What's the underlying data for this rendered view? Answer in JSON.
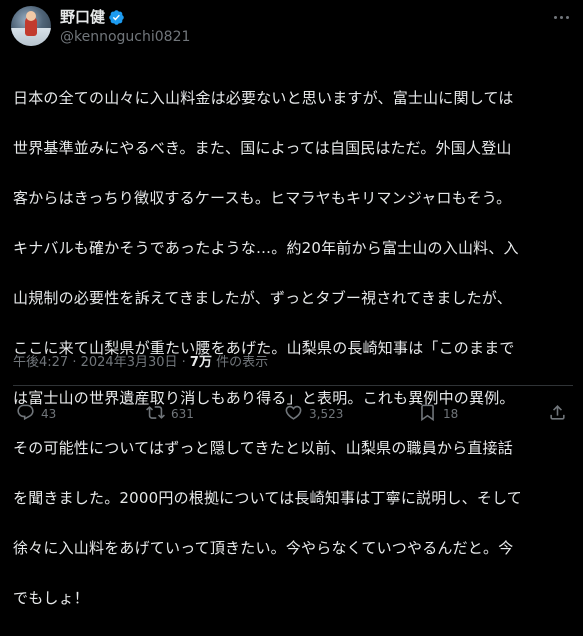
{
  "author": {
    "display_name": "野口健",
    "handle": "@kennoguchi0821",
    "verified_color": "#1d9bf0"
  },
  "post": {
    "lines": [
      "日本の全ての山々に入山料金は必要ないと思いますが、富士山に関しては",
      "世界基準並みにやるべき。また、国によっては自国民はただ。外国人登山",
      "客からはきっちり徴収するケースも。ヒマラヤもキリマンジャロもそう。",
      "キナバルも確かそうであったような…。約20年前から富士山の入山料、入",
      "山規制の必要性を訴えてきましたが、ずっとタブー視されてきましたが、",
      "ここに来て山梨県が重たい腰をあげた。山梨県の長崎知事は「このままで",
      "は富士山の世界遺産取り消しもあり得る」と表明。これも異例中の異例。",
      "その可能性についてはずっと隠してきたと以前、山梨県の職員から直接話",
      "を聞きました。2000円の根拠については長崎知事は丁寧に説明し、そして",
      "徐々に入山料をあげていって頂きたい。今やらなくていつやるんだと。今",
      "でもしょ！"
    ]
  },
  "meta": {
    "time": "午後4:27",
    "separator": " · ",
    "date": "2024年3月30日",
    "views_count": "7万",
    "views_label": " 件の表示"
  },
  "actions": {
    "replies": "43",
    "reposts": "631",
    "likes": "3,523",
    "bookmarks": "18"
  },
  "colors": {
    "background": "#000000",
    "text": "#e7e9ea",
    "secondary": "#71767b",
    "divider": "#2f3336"
  },
  "icons": [
    "verified-badge-icon",
    "more-icon",
    "reply-icon",
    "repost-icon",
    "like-icon",
    "bookmark-icon",
    "share-icon"
  ]
}
